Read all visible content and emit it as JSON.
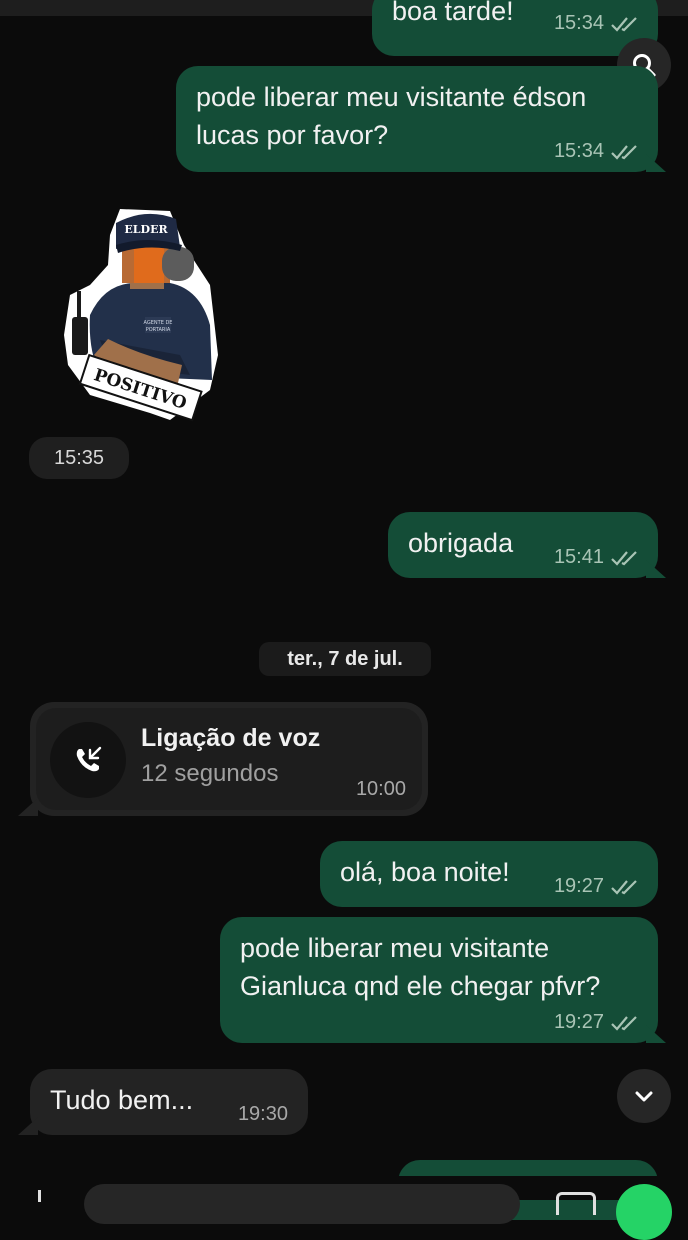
{
  "messages": {
    "m1": {
      "text": "boa tarde!",
      "time": "15:34"
    },
    "m2": {
      "line1": "pode liberar meu visitante édson",
      "line2": "lucas por favor?",
      "time": "15:34"
    },
    "sticker": {
      "cap_text": "ELDER",
      "banner_text": "POSITIVO",
      "patch_text_1": "AGENTE DE",
      "patch_text_2": "PORTARIA",
      "time": "15:35"
    },
    "m3": {
      "text": "obrigada",
      "time": "15:41"
    },
    "date_divider": "ter., 7 de jul.",
    "call": {
      "title": "Ligação de voz",
      "duration": "12 segundos",
      "time": "10:00"
    },
    "m4": {
      "text": "olá, boa noite!",
      "time": "19:27"
    },
    "m5": {
      "line1": "pode liberar meu visitante",
      "line2": "Gianluca qnd ele chegar pfvr?",
      "time": "19:27"
    },
    "m6": {
      "text": "Tudo bem...",
      "time": "19:30"
    }
  },
  "icons": {
    "read_ticks": "double-check-icon",
    "search": "search-icon",
    "scroll_down": "chevron-down-icon",
    "call": "incoming-call-icon"
  },
  "colors": {
    "outgoing_bubble": "#144d37",
    "incoming_bubble": "#232323",
    "background": "#0b0b0b",
    "accent_green": "#25d366"
  }
}
